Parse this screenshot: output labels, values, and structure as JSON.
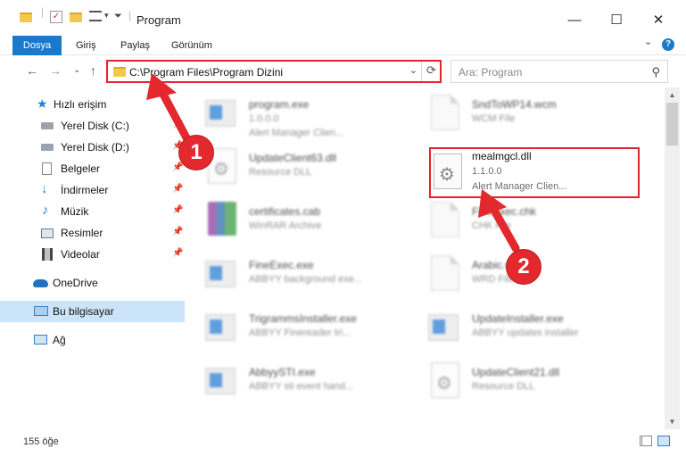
{
  "window": {
    "title": "Program",
    "controls": {
      "minimize": "—",
      "maximize": "☐",
      "close": "✕"
    }
  },
  "ribbon": {
    "tabs": [
      "Dosya",
      "Giriş",
      "Paylaş",
      "Görünüm"
    ],
    "expand_glyph": "⌄",
    "help_glyph": "?"
  },
  "nav": {
    "back": "←",
    "forward": "→",
    "recent": "⌄",
    "up": "↑",
    "address": "C:\\Program Files\\Program Dizini",
    "search_placeholder": "Ara: Program"
  },
  "sidebar": {
    "items": [
      {
        "label": "Hızlı erişim",
        "icon": "star-icon"
      },
      {
        "label": "Yerel Disk (C:)",
        "icon": "drive-icon"
      },
      {
        "label": "Yerel Disk (D:)",
        "icon": "drive-icon"
      },
      {
        "label": "Belgeler",
        "icon": "documents-icon"
      },
      {
        "label": "İndirmeler",
        "icon": "download-icon"
      },
      {
        "label": "Müzik",
        "icon": "music-icon"
      },
      {
        "label": "Resimler",
        "icon": "pictures-icon"
      },
      {
        "label": "Videolar",
        "icon": "videos-icon"
      },
      {
        "label": "OneDrive",
        "icon": "cloud-icon"
      },
      {
        "label": "Bu bilgisayar",
        "icon": "computer-icon"
      },
      {
        "label": "Ağ",
        "icon": "network-icon"
      }
    ]
  },
  "files": [
    {
      "name": "program.exe",
      "line1": "1.0.0.0",
      "line2": "Alert Manager Clien...",
      "icon": "installer-icon"
    },
    {
      "name": "SndToWP14.wcm",
      "line1": "WCM File",
      "line2": "",
      "icon": "document-icon"
    },
    {
      "name": "UpdateClient63.dll",
      "line1": "Resource DLL",
      "line2": "",
      "icon": "dll-gear-icon"
    },
    {
      "name": "mealmgcl.dll",
      "line1": "1.1.0.0",
      "line2": "Alert Manager Clien...",
      "icon": "dll-gear-icon"
    },
    {
      "name": "certificates.cab",
      "line1": "WinRAR Archive",
      "line2": "",
      "icon": "winrar-icon"
    },
    {
      "name": "FineExec.chk",
      "line1": "CHK File",
      "line2": "",
      "icon": "document-icon"
    },
    {
      "name": "FineExec.exe",
      "line1": "ABBYY background exe...",
      "line2": "",
      "icon": "exe-icon"
    },
    {
      "name": "Arabic.wrd",
      "line1": "WRD File",
      "line2": "",
      "icon": "document-icon"
    },
    {
      "name": "TrigrammsInstaller.exe",
      "line1": "ABBYY Finereader tri...",
      "line2": "",
      "icon": "exe-icon"
    },
    {
      "name": "UpdateInstaller.exe",
      "line1": "ABBYY updates installer",
      "line2": "",
      "icon": "exe-icon"
    },
    {
      "name": "AbbyySTI.exe",
      "line1": "ABBYY sti event hand...",
      "line2": "",
      "icon": "exe-icon"
    },
    {
      "name": "UpdateClient21.dll",
      "line1": "Resource DLL",
      "line2": "",
      "icon": "dll-gear-icon"
    }
  ],
  "status": {
    "item_count": "155 öğe"
  },
  "annotations": {
    "step1": "1",
    "step2": "2"
  },
  "colors": {
    "accent": "#1979ca",
    "highlight": "#e1242a",
    "selected": "#cce4f7"
  }
}
